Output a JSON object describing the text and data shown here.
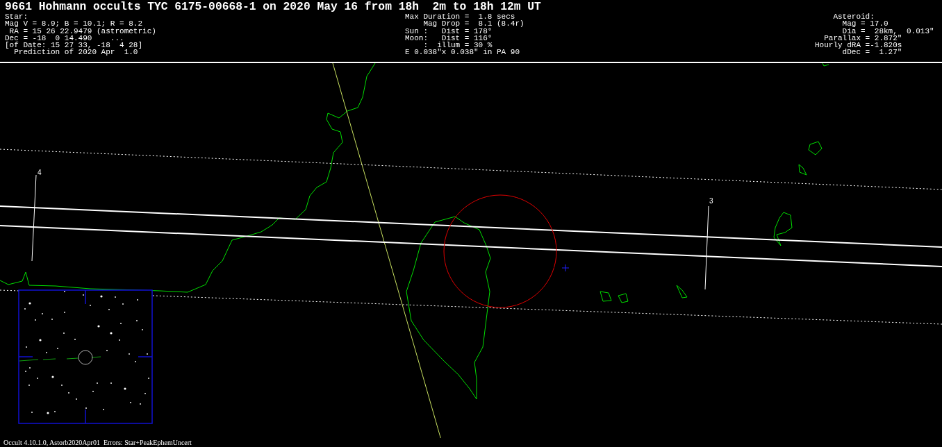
{
  "title": "9661 Hohmann occults TYC 6175-00668-1 on 2020 May 16 from 18h  2m to 18h 12m UT",
  "star_info": [
    "Star:",
    "Mag V = 8.9; B = 10.1; R = 8.2",
    " RA = 15 26 22.9479 (astrometric)",
    "Dec = -18  0 14.490    ...",
    "[of Date: 15 27 33, -18  4 28]",
    "  Prediction of 2020 Apr  1.0"
  ],
  "event_info": [
    "Max Duration =  1.8 secs",
    "    Mag Drop =  8.1 (8.4r)",
    "Sun :   Dist = 178°",
    "Moon:   Dist = 116°",
    "    :  illum = 30 %",
    "E 0.038\"x 0.038\" in PA 90"
  ],
  "asteroid_info": [
    "    Asteroid:",
    "      Mag = 17.0",
    "      Dia =  28km,  0.013\"",
    "  Parallax = 2.872\"",
    "Hourly dRA =-1.820s",
    "      dDec =  1.27\""
  ],
  "map": {
    "tick_labels": [
      "4",
      "3"
    ]
  },
  "footer": "Occult 4.10.1.0, Astorb2020Apr01  Errors: Star+PeakEphemUncert"
}
